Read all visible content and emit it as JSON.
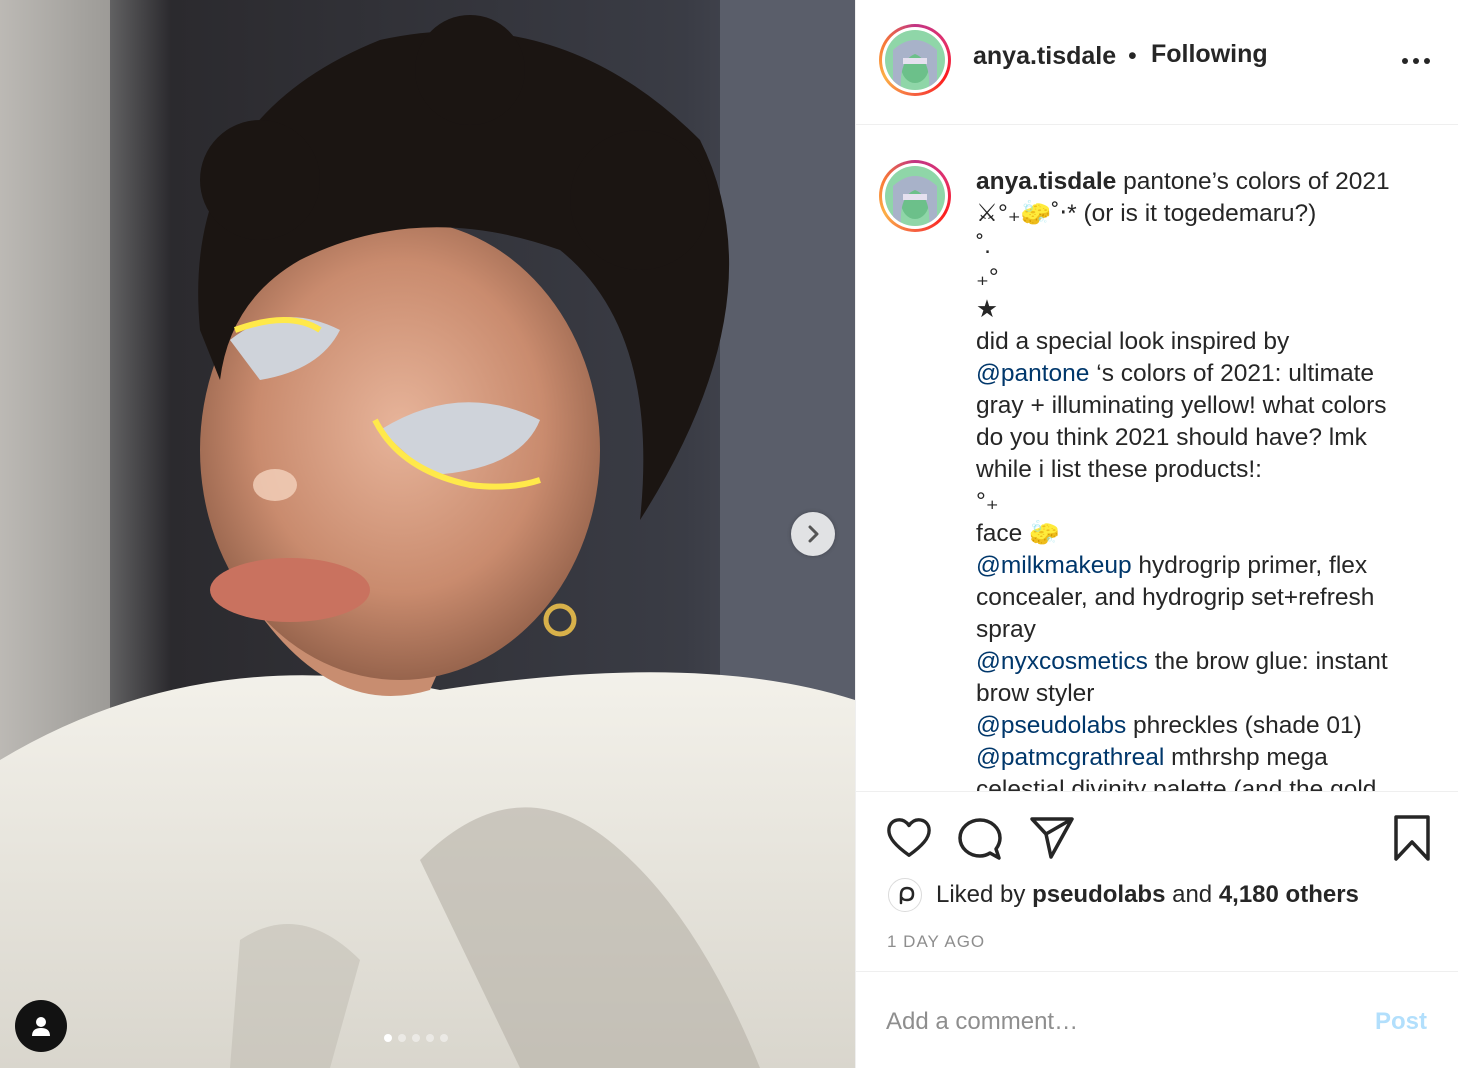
{
  "post": {
    "username": "anya.tisdale",
    "separator": "•",
    "follow_status": "Following",
    "more_icon": "more-horizontal-icon"
  },
  "caption": {
    "username": "anya.tisdale",
    "lines": {
      "l1_text": "pantone’s colors of 2021",
      "l2": "⚔°₊🧽˚‧* (or is it togedemaru?)",
      "l3": "˚.",
      "l4": "₊°",
      "l5": "★",
      "l6": "did a special look inspired by",
      "l7_mention": "@pantone",
      "l7_text": " ‘s colors of 2021: ultimate",
      "l8": "gray + illuminating yellow! what colors",
      "l9": "do you think 2021 should have? lmk",
      "l10": "while i list these products!:",
      "l11": "°₊",
      "l12": "face 🧽",
      "l13_mention": "@milkmakeup",
      "l13_text": " hydrogrip primer, flex",
      "l14": "concealer, and hydrogrip set+refresh",
      "l15": "spray",
      "l16_mention": "@nyxcosmetics",
      "l16_text": " the brow glue: instant",
      "l17": "brow styler",
      "l18_mention": "@pseudolabs",
      "l18_text": " phreckles (shade 01)",
      "l19_mention": "@patmcgrathreal",
      "l19_text": " mthrshp mega",
      "l20": "celestial divinity palette (and the gold"
    }
  },
  "actions": {
    "like_icon": "heart-icon",
    "comment_icon": "comment-icon",
    "share_icon": "paper-plane-icon",
    "save_icon": "bookmark-icon"
  },
  "likes": {
    "prefix": "Liked by",
    "liker": "pseudolabs",
    "conj": "and",
    "others": "4,180 others"
  },
  "timestamp": "1 DAY AGO",
  "comment_box": {
    "placeholder": "Add a comment…",
    "post_label": "Post"
  },
  "carousel": {
    "slide_count": 5,
    "active_index": 0
  },
  "colors": {
    "mention": "#00376b",
    "post_disabled": "#b2dffc",
    "muted": "#8e8e8e"
  }
}
